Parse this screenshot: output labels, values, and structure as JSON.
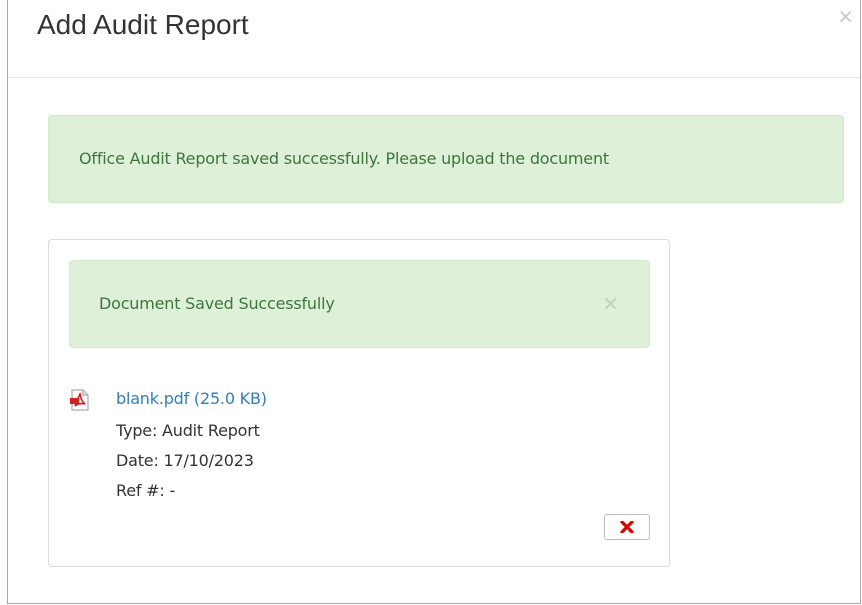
{
  "modal": {
    "title": "Add Audit Report",
    "close_glyph": "×"
  },
  "alerts": {
    "main_message": "Office Audit Report saved successfully. Please upload the document",
    "document_message": "Document Saved Successfully",
    "document_close_glyph": "×"
  },
  "document": {
    "icon": "pdf-file-icon",
    "link_text": "blank.pdf (25.0 KB)",
    "type_line": "Type: Audit Report",
    "date_line": "Date: 17/10/2023",
    "ref_line": "Ref #: -",
    "delete_icon": "red-x-icon"
  },
  "colors": {
    "alert_bg": "#dff0d8",
    "alert_text": "#3c763d",
    "link": "#2f7ec0",
    "delete_x": "#e00000"
  }
}
